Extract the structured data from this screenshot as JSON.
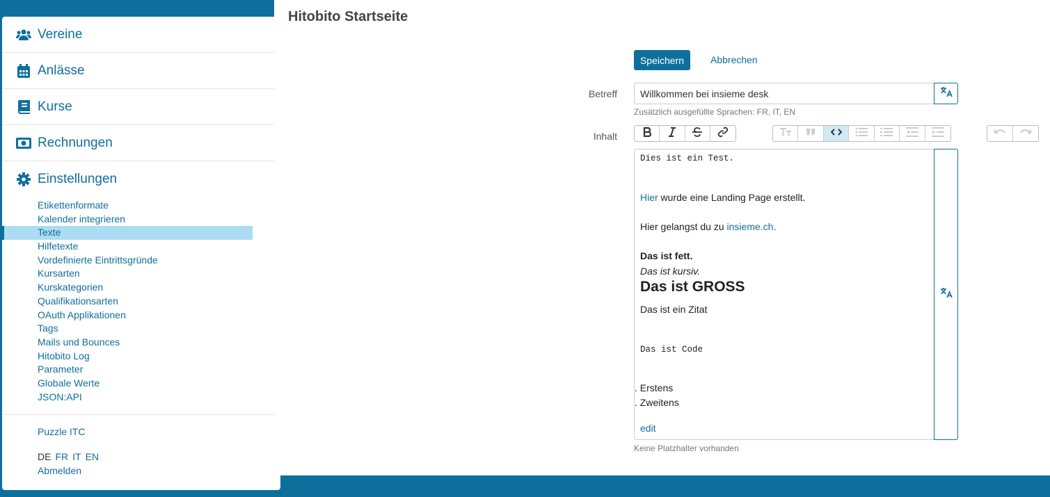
{
  "sidebar": {
    "main_items": [
      {
        "label": "Vereine",
        "icon": "users-icon"
      },
      {
        "label": "Anlässe",
        "icon": "calendar-icon"
      },
      {
        "label": "Kurse",
        "icon": "book-icon"
      },
      {
        "label": "Rechnungen",
        "icon": "money-bill-icon"
      },
      {
        "label": "Einstellungen",
        "icon": "cog-icon"
      }
    ],
    "sub_items": [
      "Etikettenformate",
      "Kalender integrieren",
      "Texte",
      "Hilfetexte",
      "Vordefinierte Eintrittsgründe",
      "Kursarten",
      "Kurskategorien",
      "Qualifikationsarten",
      "OAuth Applikationen",
      "Tags",
      "Mails und Bounces",
      "Hitobito Log",
      "Parameter",
      "Globale Werte",
      "JSON:API"
    ],
    "active_sub_item": "Texte",
    "footer": {
      "org": "Puzzle ITC",
      "languages": [
        "DE",
        "FR",
        "IT",
        "EN"
      ],
      "current_language": "DE",
      "logout": "Abmelden"
    }
  },
  "main": {
    "title": "Hitobito Startseite",
    "save_label": "Speichern",
    "cancel_label": "Abbrechen",
    "subject": {
      "label": "Betreff",
      "value": "Willkommen bei insieme desk",
      "hint": "Zusätzlich ausgefüllte Sprachen: FR, IT, EN"
    },
    "content": {
      "label": "Inhalt",
      "lines": {
        "code1": "Dies ist ein Test.",
        "link1": "Hier",
        "line1_rest": " wurde eine Landing Page erstellt.",
        "line2_pre": "Hier gelangst du zu ",
        "link2": "insieme.ch",
        "line2_post": ".",
        "bold": "Das ist fett.",
        "italic": "Das ist kursiv.",
        "big": "Das ist GROSS",
        "quote": "Das ist ein Zitat",
        "code2": "Das ist Code",
        "list1": ". Erstens",
        "list2": ". Zweitens",
        "edit": "edit"
      },
      "hint": "Keine Platzhalter vorhanden"
    },
    "toolbar": {
      "text_group": [
        "bold-icon",
        "italic-icon",
        "strikethrough-icon",
        "link-icon"
      ],
      "block_group": [
        "heading-icon",
        "quote-icon",
        "code-icon",
        "bullet-list-icon",
        "number-list-icon",
        "outdent-icon",
        "indent-icon"
      ],
      "history_group": [
        "undo-icon",
        "redo-icon"
      ]
    }
  },
  "colors": {
    "accent": "#0f6f9c",
    "active_bg": "#abdcf3",
    "page_bg": "#0f6f9c"
  }
}
